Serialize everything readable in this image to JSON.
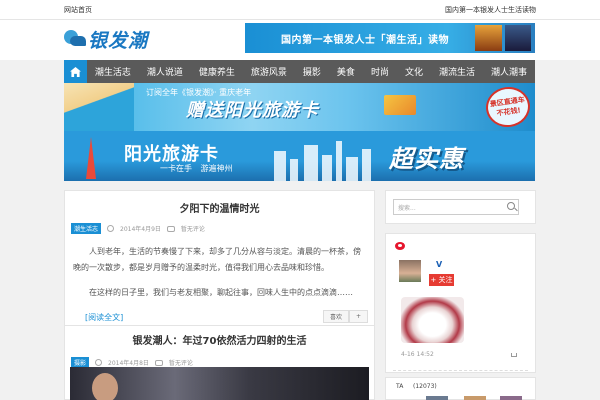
{
  "topbar": {
    "home_link": "网站首页",
    "slogan": "国内第一本银发人士生活读物"
  },
  "header": {
    "logo_text": "银发潮"
  },
  "ad_top": {
    "text": "国内第一本银发人士「潮生活」读物"
  },
  "nav": {
    "items": [
      "潮生活志",
      "潮人说道",
      "健康养生",
      "旅游风景",
      "摄影",
      "美食",
      "时尚",
      "文化",
      "潮流生活",
      "潮人潮事"
    ]
  },
  "banner1": {
    "sub": "订阅全年《银发潮》· 重庆老年",
    "main": "赠送阳光旅游卡",
    "stamp_line1": "景区直通车",
    "stamp_line2": "不花钱!"
  },
  "banner2": {
    "title": "阳光旅游卡",
    "slogan": "一卡在手 游遍神州",
    "big": "超实惠"
  },
  "posts": [
    {
      "title": "夕阳下的温情时光",
      "category": "潮生活志",
      "date": "2014年4月9日",
      "comments": "暂无评论",
      "excerpt": "人到老年，生活的节奏慢了下来，却多了几分从容与淡定。清晨的一杯茶，傍晚的一次散步，都是岁月赠予的温柔时光，值得我们用心去品味和珍惜。",
      "excerpt2": "在这样的日子里，我们与老友相聚，聊起往事，回味人生中的点点滴滴……",
      "read_more": "阅读全文",
      "action_like": "喜欢",
      "action_plus": "+"
    },
    {
      "title": "银发潮人：年过70依然活力四射的生活",
      "category": "摄影",
      "date": "2014年4月8日",
      "comments": "暂无评论"
    }
  ],
  "sidebar": {
    "search_placeholder": "搜索...",
    "weibo_name": "V",
    "follow_label": "+ 关注",
    "weibo_time": "4-16 14:52",
    "ta_label": "TA",
    "ta_count": "(12073)"
  },
  "colors": {
    "accent": "#1a8fd4",
    "nav_bg": "#5a5a5a",
    "weibo_red": "#e6162d"
  }
}
